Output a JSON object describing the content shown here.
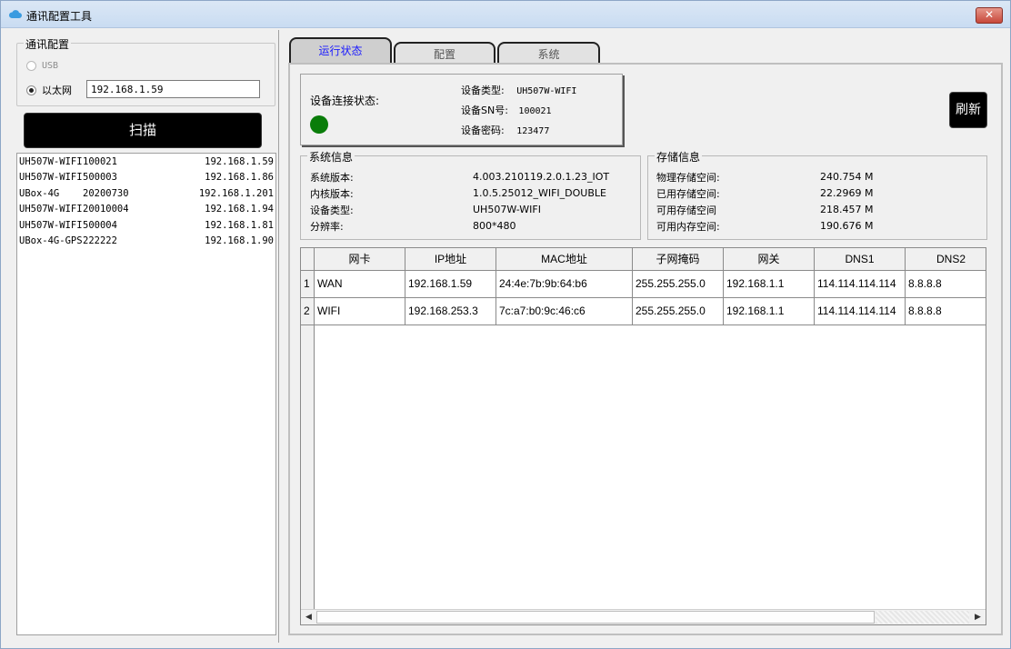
{
  "window": {
    "title": "通讯配置工具",
    "close_label": "✕"
  },
  "left": {
    "comm_group_label": "通讯配置",
    "usb_label": "USB",
    "ethernet_label": "以太网",
    "ip_value": "192.168.1.59",
    "scan_label": "扫描",
    "devices": [
      {
        "name": "UH507W-WIFI",
        "sn": "100021",
        "ip": "192.168.1.59"
      },
      {
        "name": "UH507W-WIFI",
        "sn": "500003",
        "ip": "192.168.1.86"
      },
      {
        "name": "UBox-4G",
        "sn": "20200730",
        "ip": "192.168.1.201"
      },
      {
        "name": "UH507W-WIFI",
        "sn": "20010004",
        "ip": "192.168.1.94"
      },
      {
        "name": "UH507W-WIFI",
        "sn": "500004",
        "ip": "192.168.1.81"
      },
      {
        "name": "UBox-4G-GPS",
        "sn": "222222",
        "ip": "192.168.1.90"
      }
    ]
  },
  "tabs": [
    "运行状态",
    "配置",
    "系统"
  ],
  "status": {
    "connection_label": "设备连接状态:",
    "connection_color": "#0a7d0a",
    "device_type_label": "设备类型:",
    "device_type_value": "UH507W-WIFI",
    "sn_label": "设备SN号:",
    "sn_value": "100021",
    "password_label": "设备密码:",
    "password_value": "123477",
    "refresh_label": "刷新"
  },
  "system_info": {
    "title": "系统信息",
    "rows": [
      {
        "label": "系统版本:",
        "value": "4.003.210119.2.0.1.23_IOT"
      },
      {
        "label": "内核版本:",
        "value": "1.0.5.25012_WIFI_DOUBLE"
      },
      {
        "label": "设备类型:",
        "value": "UH507W-WIFI"
      },
      {
        "label": "分辨率:",
        "value": "800*480"
      }
    ]
  },
  "storage_info": {
    "title": "存储信息",
    "rows": [
      {
        "label": "物理存储空间:",
        "value": "240.754 M"
      },
      {
        "label": "已用存储空间:",
        "value": "22.2969 M"
      },
      {
        "label": "可用存储空间",
        "value": "218.457 M"
      },
      {
        "label": "可用内存空间:",
        "value": "190.676 M"
      }
    ]
  },
  "network_table": {
    "columns": [
      "网卡",
      "IP地址",
      "MAC地址",
      "子网掩码",
      "网关",
      "DNS1",
      "DNS2"
    ],
    "rows": [
      {
        "num": "1",
        "cells": [
          "WAN",
          "192.168.1.59",
          "24:4e:7b:9b:64:b6",
          "255.255.255.0",
          "192.168.1.1",
          "114.114.114.114",
          "8.8.8.8"
        ]
      },
      {
        "num": "2",
        "cells": [
          "WIFI",
          "192.168.253.3",
          "7c:a7:b0:9c:46:c6",
          "255.255.255.0",
          "192.168.1.1",
          "114.114.114.114",
          "8.8.8.8"
        ]
      }
    ]
  }
}
